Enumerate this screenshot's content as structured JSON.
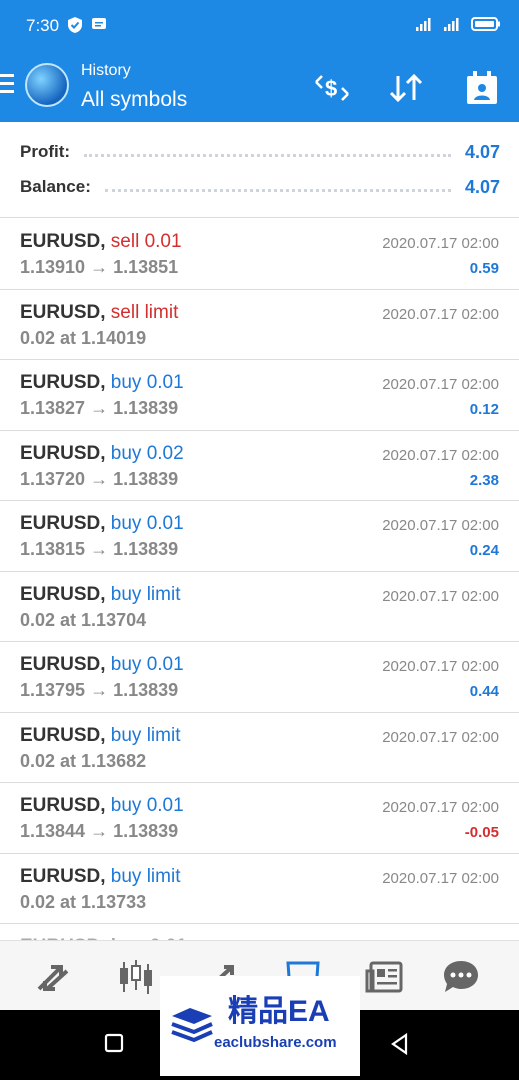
{
  "status": {
    "time": "7:30"
  },
  "header": {
    "subtitle": "History",
    "title": "All symbols"
  },
  "summary": {
    "profit_label": "Profit:",
    "profit_value": "4.07",
    "balance_label": "Balance:",
    "balance_value": "4.07"
  },
  "rows": [
    {
      "symbol": "EURUSD,",
      "action": "sell 0.01",
      "detail": "1.13910 → 1.13851",
      "date": "2020.07.17 02:00",
      "profit": "0.59"
    },
    {
      "symbol": "EURUSD,",
      "action": "sell limit",
      "detail": "0.02 at 1.14019",
      "date": "2020.07.17 02:00",
      "profit": ""
    },
    {
      "symbol": "EURUSD,",
      "action": "buy 0.01",
      "detail": "1.13827 → 1.13839",
      "date": "2020.07.17 02:00",
      "profit": "0.12"
    },
    {
      "symbol": "EURUSD,",
      "action": "buy 0.02",
      "detail": "1.13720 → 1.13839",
      "date": "2020.07.17 02:00",
      "profit": "2.38"
    },
    {
      "symbol": "EURUSD,",
      "action": "buy 0.01",
      "detail": "1.13815 → 1.13839",
      "date": "2020.07.17 02:00",
      "profit": "0.24"
    },
    {
      "symbol": "EURUSD,",
      "action": "buy limit",
      "detail": "0.02 at 1.13704",
      "date": "2020.07.17 02:00",
      "profit": ""
    },
    {
      "symbol": "EURUSD,",
      "action": "buy 0.01",
      "detail": "1.13795 → 1.13839",
      "date": "2020.07.17 02:00",
      "profit": "0.44"
    },
    {
      "symbol": "EURUSD,",
      "action": "buy limit",
      "detail": "0.02 at 1.13682",
      "date": "2020.07.17 02:00",
      "profit": ""
    },
    {
      "symbol": "EURUSD,",
      "action": "buy 0.01",
      "detail": "1.13844 → 1.13839",
      "date": "2020.07.17 02:00",
      "profit": "-0.05"
    },
    {
      "symbol": "EURUSD,",
      "action": "buy limit",
      "detail": "0.02 at 1.13733",
      "date": "2020.07.17 02:00",
      "profit": ""
    }
  ],
  "watermark": {
    "text": "精品EA",
    "url": "eaclubshare.com"
  },
  "colors": {
    "primary": "#1e88e5",
    "sell": "#d32f2f",
    "buy": "#1e78d7"
  }
}
